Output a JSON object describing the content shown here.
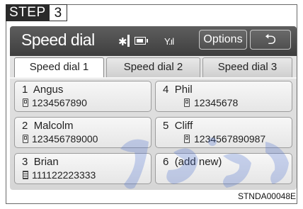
{
  "step": {
    "label": "STEP",
    "number": "3"
  },
  "header": {
    "title": "Speed dial",
    "bluetooth_icon": "bluetooth-icon",
    "battery_icon": "battery-icon",
    "signal_icon": "signal-icon",
    "options_label": "Options",
    "back_label": "⮌"
  },
  "tabs": [
    {
      "label": "Speed dial 1",
      "active": true
    },
    {
      "label": "Speed dial 2",
      "active": false
    },
    {
      "label": "Speed dial 3",
      "active": false
    }
  ],
  "entries": [
    {
      "slot": "1",
      "name": "Angus",
      "number": "1234567890",
      "phone_type": "mobile"
    },
    {
      "slot": "4",
      "name": "Phil",
      "number": "12345678",
      "phone_type": "mobile"
    },
    {
      "slot": "2",
      "name": "Malcolm",
      "number": "123456789000",
      "phone_type": "mobile"
    },
    {
      "slot": "5",
      "name": "Cliff",
      "number": "1234567890987",
      "phone_type": "mobile"
    },
    {
      "slot": "3",
      "name": "Brian",
      "number": "111122223333",
      "phone_type": "home"
    },
    {
      "slot": "6",
      "name": "(add new)",
      "number": "",
      "phone_type": ""
    }
  ],
  "caption": "STNDA00048E",
  "colors": {
    "header": "#4a4a4a",
    "screen_bg": "#dcdcdc",
    "watermark": "#4a6fd0"
  }
}
